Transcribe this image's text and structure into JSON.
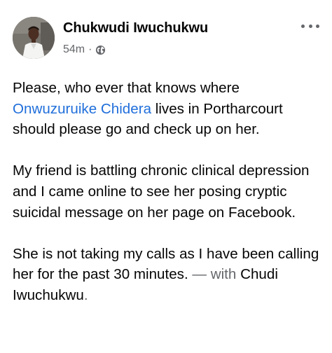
{
  "post": {
    "author": "Chukwudi Iwuchukwu",
    "time": "54m",
    "separator": "·",
    "privacy_icon": "globe-icon",
    "more_icon": "more-options-icon",
    "paragraph1": {
      "before": "Please, who ever that knows where ",
      "mention": "Onwuzuruike Chidera",
      "after": " lives in Portharcourt should please go and check up on her."
    },
    "paragraph2": "My friend is battling chronic clinical depression and I came online to see her posing cryptic suicidal message on her page on Facebook.",
    "paragraph3": {
      "text": "She is not taking my calls as I have been calling her for the past 30 minutes. ",
      "with_label": "— with",
      "tagged": "Chudi Iwuchukwu",
      "end": "."
    }
  },
  "colors": {
    "text": "#050505",
    "secondary": "#65676b",
    "link": "#216fdb"
  }
}
